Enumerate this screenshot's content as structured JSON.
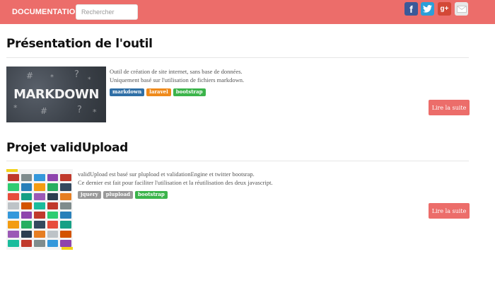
{
  "navbar": {
    "brand": "DOCUMENTATION",
    "search_placeholder": "Rechercher",
    "social": {
      "facebook": "f",
      "twitter_icon": "twitter-icon",
      "googleplus": "g+",
      "mail_icon": "mail-icon"
    }
  },
  "articles": [
    {
      "title": "Présentation de l'outil",
      "thumbnail_text": "MARKDOWN",
      "description": [
        "Outil de création de site internet, sans base de données.",
        "Uniquement basé sur l'utilisation de fichiers markdown."
      ],
      "tags": [
        {
          "label": "markdown",
          "color": "#2f6fa6"
        },
        {
          "label": "laravel",
          "color": "#ef8a1b"
        },
        {
          "label": "bootstrap",
          "color": "#3cb44b"
        }
      ],
      "button": "Lire la suite"
    },
    {
      "title": "Projet validUpload",
      "description": [
        "validUpload est basé sur plupload et validationEngine et twitter bootsrap.",
        "Ce dernier est fait pour faciliter l'utilisation et la réutilisation des deux javascript."
      ],
      "tags": [
        {
          "label": "jquery",
          "color": "#999999"
        },
        {
          "label": "plupload",
          "color": "#999999"
        },
        {
          "label": "bootstrap",
          "color": "#3cb44b"
        }
      ],
      "button": "Lire la suite"
    }
  ],
  "colors": {
    "accent": "#ec6d6a"
  }
}
